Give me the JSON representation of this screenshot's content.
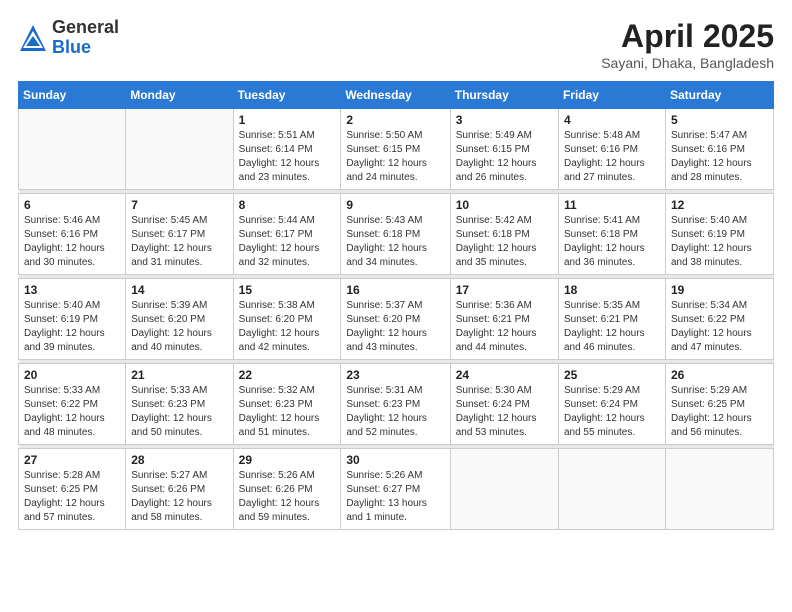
{
  "logo": {
    "general": "General",
    "blue": "Blue"
  },
  "title": "April 2025",
  "subtitle": "Sayani, Dhaka, Bangladesh",
  "days_of_week": [
    "Sunday",
    "Monday",
    "Tuesday",
    "Wednesday",
    "Thursday",
    "Friday",
    "Saturday"
  ],
  "weeks": [
    [
      {
        "day": "",
        "info": ""
      },
      {
        "day": "",
        "info": ""
      },
      {
        "day": "1",
        "info": "Sunrise: 5:51 AM\nSunset: 6:14 PM\nDaylight: 12 hours and 23 minutes."
      },
      {
        "day": "2",
        "info": "Sunrise: 5:50 AM\nSunset: 6:15 PM\nDaylight: 12 hours and 24 minutes."
      },
      {
        "day": "3",
        "info": "Sunrise: 5:49 AM\nSunset: 6:15 PM\nDaylight: 12 hours and 26 minutes."
      },
      {
        "day": "4",
        "info": "Sunrise: 5:48 AM\nSunset: 6:16 PM\nDaylight: 12 hours and 27 minutes."
      },
      {
        "day": "5",
        "info": "Sunrise: 5:47 AM\nSunset: 6:16 PM\nDaylight: 12 hours and 28 minutes."
      }
    ],
    [
      {
        "day": "6",
        "info": "Sunrise: 5:46 AM\nSunset: 6:16 PM\nDaylight: 12 hours and 30 minutes."
      },
      {
        "day": "7",
        "info": "Sunrise: 5:45 AM\nSunset: 6:17 PM\nDaylight: 12 hours and 31 minutes."
      },
      {
        "day": "8",
        "info": "Sunrise: 5:44 AM\nSunset: 6:17 PM\nDaylight: 12 hours and 32 minutes."
      },
      {
        "day": "9",
        "info": "Sunrise: 5:43 AM\nSunset: 6:18 PM\nDaylight: 12 hours and 34 minutes."
      },
      {
        "day": "10",
        "info": "Sunrise: 5:42 AM\nSunset: 6:18 PM\nDaylight: 12 hours and 35 minutes."
      },
      {
        "day": "11",
        "info": "Sunrise: 5:41 AM\nSunset: 6:18 PM\nDaylight: 12 hours and 36 minutes."
      },
      {
        "day": "12",
        "info": "Sunrise: 5:40 AM\nSunset: 6:19 PM\nDaylight: 12 hours and 38 minutes."
      }
    ],
    [
      {
        "day": "13",
        "info": "Sunrise: 5:40 AM\nSunset: 6:19 PM\nDaylight: 12 hours and 39 minutes."
      },
      {
        "day": "14",
        "info": "Sunrise: 5:39 AM\nSunset: 6:20 PM\nDaylight: 12 hours and 40 minutes."
      },
      {
        "day": "15",
        "info": "Sunrise: 5:38 AM\nSunset: 6:20 PM\nDaylight: 12 hours and 42 minutes."
      },
      {
        "day": "16",
        "info": "Sunrise: 5:37 AM\nSunset: 6:20 PM\nDaylight: 12 hours and 43 minutes."
      },
      {
        "day": "17",
        "info": "Sunrise: 5:36 AM\nSunset: 6:21 PM\nDaylight: 12 hours and 44 minutes."
      },
      {
        "day": "18",
        "info": "Sunrise: 5:35 AM\nSunset: 6:21 PM\nDaylight: 12 hours and 46 minutes."
      },
      {
        "day": "19",
        "info": "Sunrise: 5:34 AM\nSunset: 6:22 PM\nDaylight: 12 hours and 47 minutes."
      }
    ],
    [
      {
        "day": "20",
        "info": "Sunrise: 5:33 AM\nSunset: 6:22 PM\nDaylight: 12 hours and 48 minutes."
      },
      {
        "day": "21",
        "info": "Sunrise: 5:33 AM\nSunset: 6:23 PM\nDaylight: 12 hours and 50 minutes."
      },
      {
        "day": "22",
        "info": "Sunrise: 5:32 AM\nSunset: 6:23 PM\nDaylight: 12 hours and 51 minutes."
      },
      {
        "day": "23",
        "info": "Sunrise: 5:31 AM\nSunset: 6:23 PM\nDaylight: 12 hours and 52 minutes."
      },
      {
        "day": "24",
        "info": "Sunrise: 5:30 AM\nSunset: 6:24 PM\nDaylight: 12 hours and 53 minutes."
      },
      {
        "day": "25",
        "info": "Sunrise: 5:29 AM\nSunset: 6:24 PM\nDaylight: 12 hours and 55 minutes."
      },
      {
        "day": "26",
        "info": "Sunrise: 5:29 AM\nSunset: 6:25 PM\nDaylight: 12 hours and 56 minutes."
      }
    ],
    [
      {
        "day": "27",
        "info": "Sunrise: 5:28 AM\nSunset: 6:25 PM\nDaylight: 12 hours and 57 minutes."
      },
      {
        "day": "28",
        "info": "Sunrise: 5:27 AM\nSunset: 6:26 PM\nDaylight: 12 hours and 58 minutes."
      },
      {
        "day": "29",
        "info": "Sunrise: 5:26 AM\nSunset: 6:26 PM\nDaylight: 12 hours and 59 minutes."
      },
      {
        "day": "30",
        "info": "Sunrise: 5:26 AM\nSunset: 6:27 PM\nDaylight: 13 hours and 1 minute."
      },
      {
        "day": "",
        "info": ""
      },
      {
        "day": "",
        "info": ""
      },
      {
        "day": "",
        "info": ""
      }
    ]
  ]
}
